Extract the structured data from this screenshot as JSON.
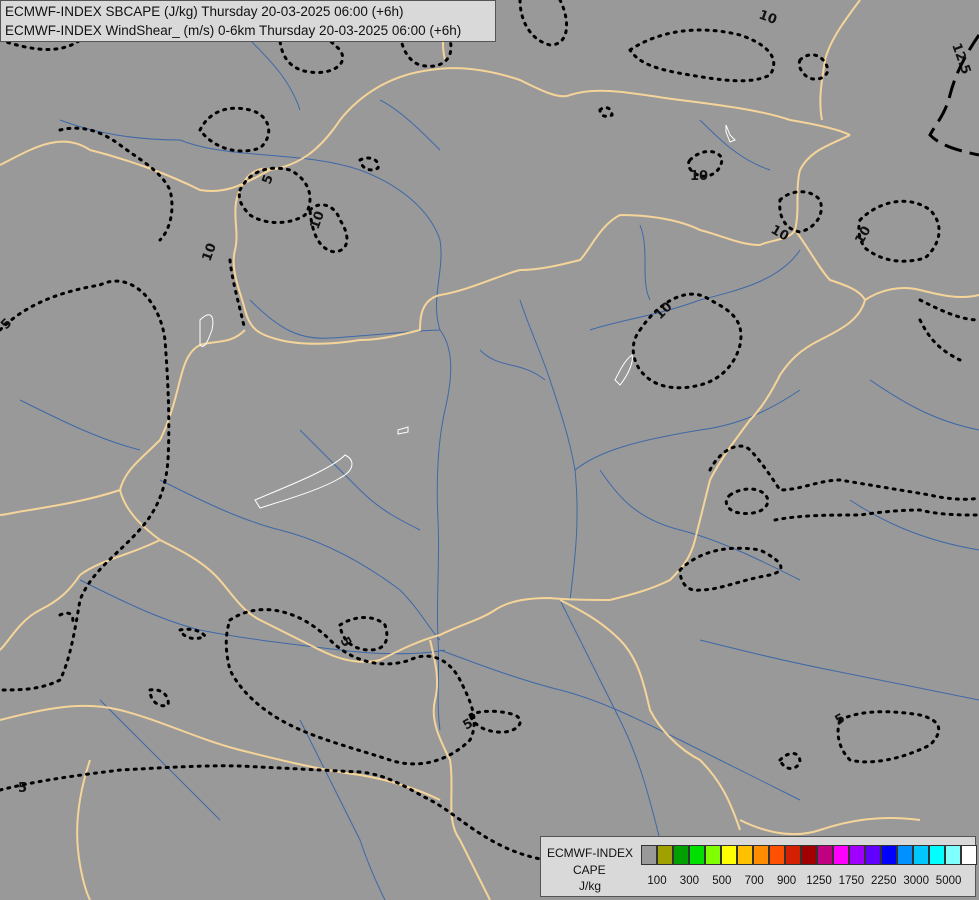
{
  "header": {
    "line1": "ECMWF-INDEX SBCAPE (J/kg) Thursday 20-03-2025 06:00 (+6h)",
    "line2": "ECMWF-INDEX WindShear_ (m/s) 0-6km Thursday 20-03-2025 06:00 (+6h)"
  },
  "legend": {
    "title": "ECMWF-INDEX",
    "subtitle": "CAPE",
    "unit": "J/kg",
    "tick_labels": [
      "100",
      "300",
      "500",
      "700",
      "900",
      "1250",
      "1750",
      "2250",
      "3000",
      "5000"
    ],
    "colors": [
      "#999999",
      "#a0a000",
      "#00a000",
      "#00e000",
      "#80ff00",
      "#ffff00",
      "#ffc000",
      "#ff8c00",
      "#ff5000",
      "#d22000",
      "#a00000",
      "#c00080",
      "#ff00ff",
      "#a000ff",
      "#6000ff",
      "#0000ff",
      "#0090ff",
      "#00c8ff",
      "#00ffff",
      "#80ffff",
      "#ffffff"
    ]
  },
  "contour_labels": [
    "10",
    "10",
    "10",
    "10",
    "10",
    "10",
    "10",
    "12.5",
    "5",
    "5",
    "5",
    "5",
    "5",
    "5"
  ],
  "colors": {
    "background": "#999999",
    "borders": "#f5d49a",
    "rivers": "#3e68a8",
    "contours": "#000000",
    "lakes": "#ffffff"
  }
}
